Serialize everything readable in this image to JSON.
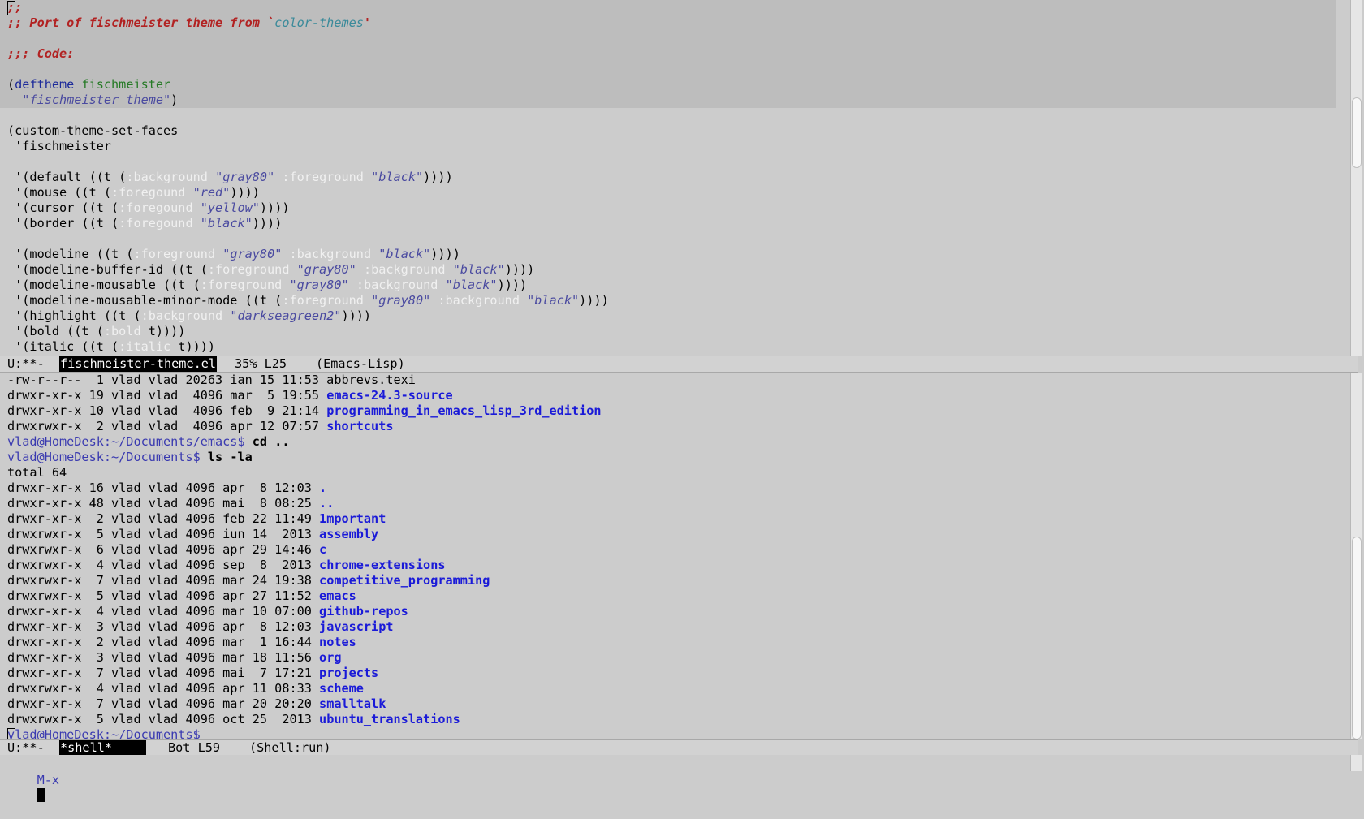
{
  "editor": {
    "header_lines": [
      {
        "parts": [
          {
            "t": ";;",
            "c": "c-comment"
          }
        ],
        "cursor": true
      },
      {
        "parts": [
          {
            "t": ";; Port of fischmeister theme from `",
            "c": "c-comment"
          },
          {
            "t": "color-themes",
            "c": "c-quote"
          },
          {
            "t": "'",
            "c": "c-comment"
          }
        ]
      },
      {
        "parts": []
      },
      {
        "parts": [
          {
            "t": ";;; Code:",
            "c": "c-comment"
          }
        ]
      },
      {
        "parts": []
      },
      {
        "parts": [
          {
            "t": "("
          },
          {
            "t": "deftheme",
            "c": "c-kw"
          },
          {
            "t": " "
          },
          {
            "t": "fischmeister",
            "c": "c-fn"
          }
        ]
      },
      {
        "parts": [
          {
            "t": "  "
          },
          {
            "t": "\"fischmeister theme\"",
            "c": "c-str"
          },
          {
            "t": ")"
          }
        ]
      }
    ],
    "body_lines": [
      {
        "parts": []
      },
      {
        "parts": [
          {
            "t": "(custom-theme-set-faces"
          }
        ]
      },
      {
        "parts": [
          {
            "t": " 'fischmeister"
          }
        ]
      },
      {
        "parts": []
      },
      {
        "parts": [
          {
            "t": " '(default ((t ("
          },
          {
            "t": ":background",
            "c": "c-builtin"
          },
          {
            "t": " "
          },
          {
            "t": "\"gray80\"",
            "c": "c-str"
          },
          {
            "t": " "
          },
          {
            "t": ":foreground",
            "c": "c-builtin"
          },
          {
            "t": " "
          },
          {
            "t": "\"black\"",
            "c": "c-str"
          },
          {
            "t": "))))"
          }
        ]
      },
      {
        "parts": [
          {
            "t": " '(mouse ((t ("
          },
          {
            "t": ":foregound",
            "c": "c-builtin"
          },
          {
            "t": " "
          },
          {
            "t": "\"red\"",
            "c": "c-str"
          },
          {
            "t": "))))"
          }
        ]
      },
      {
        "parts": [
          {
            "t": " '(cursor ((t ("
          },
          {
            "t": ":foregound",
            "c": "c-builtin"
          },
          {
            "t": " "
          },
          {
            "t": "\"yellow\"",
            "c": "c-str"
          },
          {
            "t": "))))"
          }
        ]
      },
      {
        "parts": [
          {
            "t": " '(border ((t ("
          },
          {
            "t": ":foregound",
            "c": "c-builtin"
          },
          {
            "t": " "
          },
          {
            "t": "\"black\"",
            "c": "c-str"
          },
          {
            "t": "))))"
          }
        ]
      },
      {
        "parts": []
      },
      {
        "parts": [
          {
            "t": " '(modeline ((t ("
          },
          {
            "t": ":foreground",
            "c": "c-builtin"
          },
          {
            "t": " "
          },
          {
            "t": "\"gray80\"",
            "c": "c-str"
          },
          {
            "t": " "
          },
          {
            "t": ":background",
            "c": "c-builtin"
          },
          {
            "t": " "
          },
          {
            "t": "\"black\"",
            "c": "c-str"
          },
          {
            "t": "))))"
          }
        ]
      },
      {
        "parts": [
          {
            "t": " '(modeline-buffer-id ((t ("
          },
          {
            "t": ":foreground",
            "c": "c-builtin"
          },
          {
            "t": " "
          },
          {
            "t": "\"gray80\"",
            "c": "c-str"
          },
          {
            "t": " "
          },
          {
            "t": ":background",
            "c": "c-builtin"
          },
          {
            "t": " "
          },
          {
            "t": "\"black\"",
            "c": "c-str"
          },
          {
            "t": "))))"
          }
        ]
      },
      {
        "parts": [
          {
            "t": " '(modeline-mousable ((t ("
          },
          {
            "t": ":foreground",
            "c": "c-builtin"
          },
          {
            "t": " "
          },
          {
            "t": "\"gray80\"",
            "c": "c-str"
          },
          {
            "t": " "
          },
          {
            "t": ":background",
            "c": "c-builtin"
          },
          {
            "t": " "
          },
          {
            "t": "\"black\"",
            "c": "c-str"
          },
          {
            "t": "))))"
          }
        ]
      },
      {
        "parts": [
          {
            "t": " '(modeline-mousable-minor-mode ((t ("
          },
          {
            "t": ":foreground",
            "c": "c-builtin"
          },
          {
            "t": " "
          },
          {
            "t": "\"gray80\"",
            "c": "c-str"
          },
          {
            "t": " "
          },
          {
            "t": ":background",
            "c": "c-builtin"
          },
          {
            "t": " "
          },
          {
            "t": "\"black\"",
            "c": "c-str"
          },
          {
            "t": "))))"
          }
        ]
      },
      {
        "parts": [
          {
            "t": " '(highlight ((t ("
          },
          {
            "t": ":background",
            "c": "c-builtin"
          },
          {
            "t": " "
          },
          {
            "t": "\"darkseagreen2\"",
            "c": "c-str"
          },
          {
            "t": "))))"
          }
        ]
      },
      {
        "parts": [
          {
            "t": " '(bold ((t ("
          },
          {
            "t": ":bold",
            "c": "c-builtin"
          },
          {
            "t": " t))))"
          }
        ]
      },
      {
        "parts": [
          {
            "t": " '(italic ((t ("
          },
          {
            "t": ":italic",
            "c": "c-builtin"
          },
          {
            "t": " t))))"
          }
        ]
      }
    ],
    "scroll_percent": 35
  },
  "modeline_top": {
    "status": "U:**-",
    "buffer": "fischmeister-theme.el",
    "position": "35% L25",
    "mode": "(Emacs-Lisp)"
  },
  "shell": {
    "lines": [
      {
        "parts": [
          {
            "t": "-rw-r--r--  1 vlad vlad 20263 ian 15 11:53 abbrevs.texi"
          }
        ]
      },
      {
        "parts": [
          {
            "t": "drwxr-xr-x 19 vlad vlad  4096 mar  5 19:55 "
          },
          {
            "t": "emacs-24.3-source",
            "c": "c-dir"
          }
        ]
      },
      {
        "parts": [
          {
            "t": "drwxr-xr-x 10 vlad vlad  4096 feb  9 21:14 "
          },
          {
            "t": "programming_in_emacs_lisp_3rd_edition",
            "c": "c-dir"
          }
        ]
      },
      {
        "parts": [
          {
            "t": "drwxrwxr-x  2 vlad vlad  4096 apr 12 07:57 "
          },
          {
            "t": "shortcuts",
            "c": "c-dir"
          }
        ]
      },
      {
        "parts": [
          {
            "t": "vlad@HomeDesk:~/Documents/emacs$",
            "c": "c-prompt"
          },
          {
            "t": " "
          },
          {
            "t": "cd ..",
            "c": "c-cmd"
          }
        ]
      },
      {
        "parts": [
          {
            "t": "vlad@HomeDesk:~/Documents$",
            "c": "c-prompt"
          },
          {
            "t": " "
          },
          {
            "t": "ls -la",
            "c": "c-cmd"
          }
        ]
      },
      {
        "parts": [
          {
            "t": "total 64"
          }
        ]
      },
      {
        "parts": [
          {
            "t": "drwxr-xr-x 16 vlad vlad 4096 apr  8 12:03 "
          },
          {
            "t": ".",
            "c": "c-dir"
          }
        ]
      },
      {
        "parts": [
          {
            "t": "drwxr-xr-x 48 vlad vlad 4096 mai  8 08:25 "
          },
          {
            "t": "..",
            "c": "c-dir"
          }
        ]
      },
      {
        "parts": [
          {
            "t": "drwxr-xr-x  2 vlad vlad 4096 feb 22 11:49 "
          },
          {
            "t": "1mportant",
            "c": "c-dir"
          }
        ]
      },
      {
        "parts": [
          {
            "t": "drwxrwxr-x  5 vlad vlad 4096 iun 14  2013 "
          },
          {
            "t": "assembly",
            "c": "c-dir"
          }
        ]
      },
      {
        "parts": [
          {
            "t": "drwxrwxr-x  6 vlad vlad 4096 apr 29 14:46 "
          },
          {
            "t": "c",
            "c": "c-dir"
          }
        ]
      },
      {
        "parts": [
          {
            "t": "drwxrwxr-x  4 vlad vlad 4096 sep  8  2013 "
          },
          {
            "t": "chrome-extensions",
            "c": "c-dir"
          }
        ]
      },
      {
        "parts": [
          {
            "t": "drwxrwxr-x  7 vlad vlad 4096 mar 24 19:38 "
          },
          {
            "t": "competitive_programming",
            "c": "c-dir"
          }
        ]
      },
      {
        "parts": [
          {
            "t": "drwxrwxr-x  5 vlad vlad 4096 apr 27 11:52 "
          },
          {
            "t": "emacs",
            "c": "c-dir"
          }
        ]
      },
      {
        "parts": [
          {
            "t": "drwxr-xr-x  4 vlad vlad 4096 mar 10 07:00 "
          },
          {
            "t": "github-repos",
            "c": "c-dir"
          }
        ]
      },
      {
        "parts": [
          {
            "t": "drwxr-xr-x  3 vlad vlad 4096 apr  8 12:03 "
          },
          {
            "t": "javascript",
            "c": "c-dir"
          }
        ]
      },
      {
        "parts": [
          {
            "t": "drwxr-xr-x  2 vlad vlad 4096 mar  1 16:44 "
          },
          {
            "t": "notes",
            "c": "c-dir"
          }
        ]
      },
      {
        "parts": [
          {
            "t": "drwxr-xr-x  3 vlad vlad 4096 mar 18 11:56 "
          },
          {
            "t": "org",
            "c": "c-dir"
          }
        ]
      },
      {
        "parts": [
          {
            "t": "drwxr-xr-x  7 vlad vlad 4096 mai  7 17:21 "
          },
          {
            "t": "projects",
            "c": "c-dir"
          }
        ]
      },
      {
        "parts": [
          {
            "t": "drwxrwxr-x  4 vlad vlad 4096 apr 11 08:33 "
          },
          {
            "t": "scheme",
            "c": "c-dir"
          }
        ]
      },
      {
        "parts": [
          {
            "t": "drwxr-xr-x  7 vlad vlad 4096 mar 20 20:20 "
          },
          {
            "t": "smalltalk",
            "c": "c-dir"
          }
        ]
      },
      {
        "parts": [
          {
            "t": "drwxrwxr-x  5 vlad vlad 4096 oct 25  2013 "
          },
          {
            "t": "ubuntu_translations",
            "c": "c-dir"
          }
        ]
      },
      {
        "parts": [
          {
            "t": "vlad@HomeDesk:~/Documents$",
            "c": "c-prompt"
          },
          {
            "t": " "
          }
        ],
        "cursor": true
      }
    ]
  },
  "modeline_bottom": {
    "status": "U:**-",
    "buffer": "*shell*",
    "position": "Bot L59",
    "mode": "(Shell:run)"
  },
  "minibuffer": {
    "prompt": "M-x"
  },
  "colors": {
    "background": "#cccccc",
    "comment": "#b22222",
    "keyword": "#1c2a9a",
    "function_name": "#267a26",
    "string": "#4a4aa0",
    "builtin": "#f0f0f0",
    "prompt": "#3a3ab0",
    "directory": "#1a1ad8"
  }
}
